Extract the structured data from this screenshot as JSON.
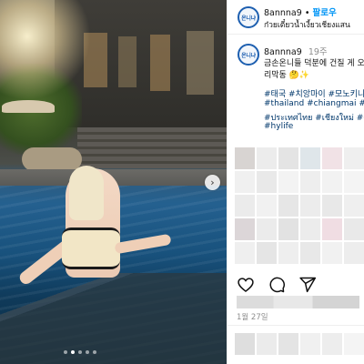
{
  "post": {
    "username": "8annna9",
    "separator": "•",
    "follow_label": "팔로우",
    "location": "ก๋วยเตี๋ยวน้ำเงี้ยวเชียงแสน",
    "avatar_logo_text": "온니냐"
  },
  "caption": {
    "username": "8annna9",
    "time_ago": "19주",
    "line1": "금손온니들 덕분에 건질 게 오",
    "line2": "리막동 🤔✨",
    "hashtags_line1": "#태국 #치앙마이 #모노키니 #",
    "hashtags_line2": "#thailand #chiangmai #hot",
    "hashtags_line3": "#ประเทศไทย #เชียงใหม่ #ตั๊ก",
    "hashtags_line4": "#hylife"
  },
  "photo": {
    "next_glyph": "›",
    "carousel_dots": 5,
    "active_dot": 1
  },
  "actions": {
    "icons": [
      "heart-icon",
      "comment-icon",
      "share-icon"
    ]
  },
  "meta": {
    "date": "1월 27일"
  },
  "colors": {
    "follow": "#0095f6",
    "hashtag": "#00376b",
    "muted": "#8e8e8e",
    "avatar_ring": "#1d5fb0"
  }
}
